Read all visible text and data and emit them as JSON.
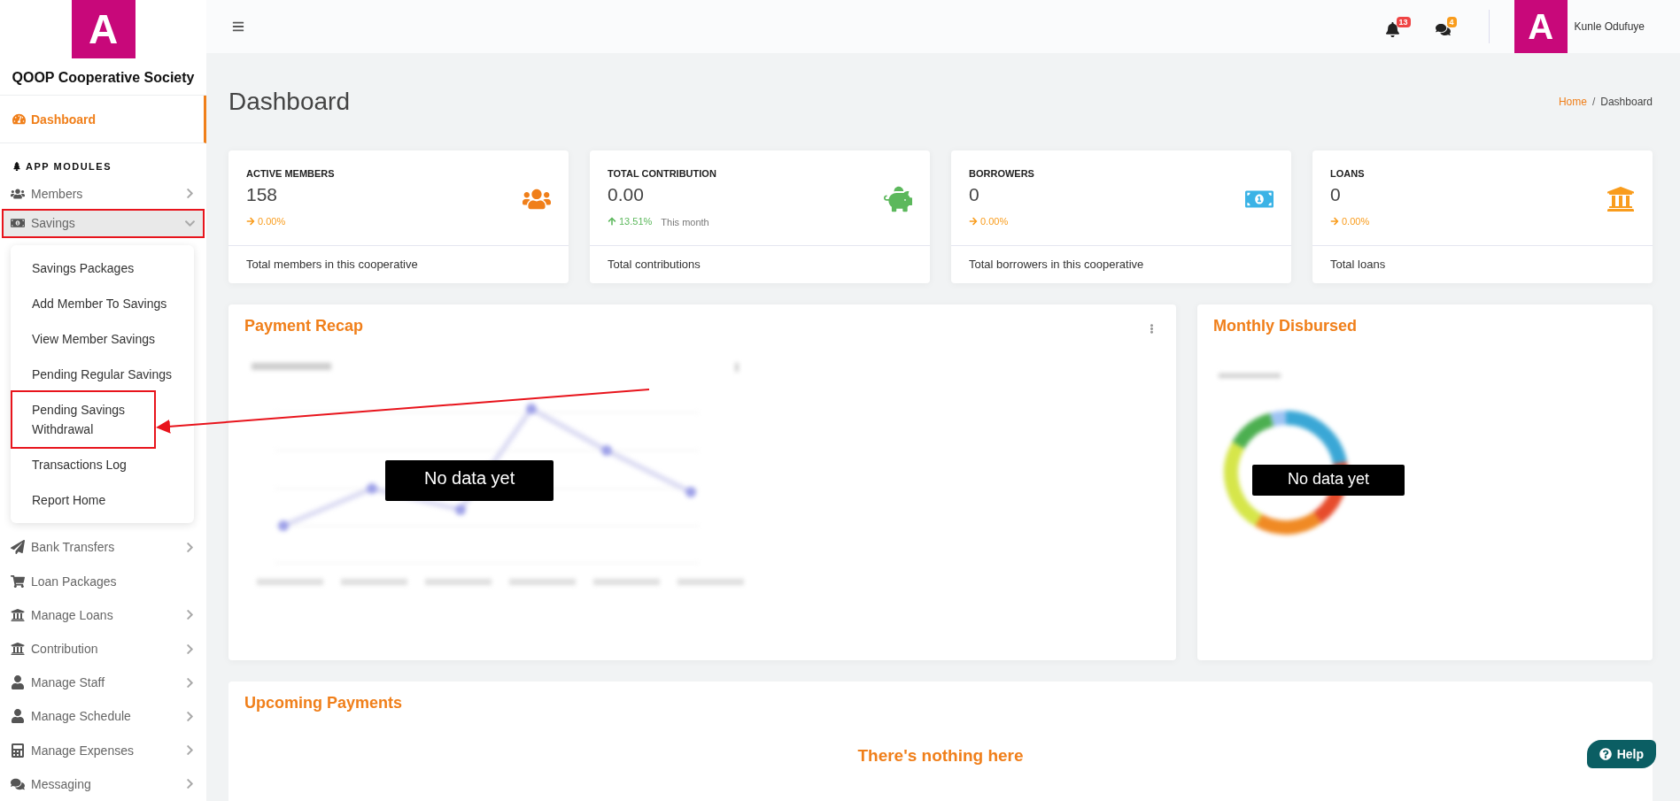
{
  "brand": {
    "logo_letter": "A",
    "name": "QOOP Cooperative Society"
  },
  "sidebar": {
    "top_item": {
      "label": "Dashboard",
      "selected": true
    },
    "section_title": "APP MODULES",
    "items": [
      {
        "label": "Members",
        "expandable": true,
        "expanded": false,
        "highlighted": false
      },
      {
        "label": "Savings",
        "expandable": true,
        "expanded": true,
        "highlighted": true,
        "children": [
          {
            "label": "Savings Packages",
            "highlighted": false
          },
          {
            "label": "Add Member To Savings",
            "highlighted": false
          },
          {
            "label": "View Member Savings",
            "highlighted": false
          },
          {
            "label": "Pending Regular Savings",
            "highlighted": false
          },
          {
            "label": "Pending Savings Withdrawal",
            "highlighted": true
          },
          {
            "label": "Transactions Log",
            "highlighted": false
          },
          {
            "label": "Report Home",
            "highlighted": false
          }
        ]
      },
      {
        "label": "Bank Transfers",
        "expandable": true,
        "expanded": false,
        "highlighted": false
      },
      {
        "label": "Loan Packages",
        "expandable": false,
        "expanded": false,
        "highlighted": false
      },
      {
        "label": "Manage Loans",
        "expandable": true,
        "expanded": false,
        "highlighted": false
      },
      {
        "label": "Contribution",
        "expandable": true,
        "expanded": false,
        "highlighted": false
      },
      {
        "label": "Manage Staff",
        "expandable": true,
        "expanded": false,
        "highlighted": false
      },
      {
        "label": "Manage Schedule",
        "expandable": true,
        "expanded": false,
        "highlighted": false
      },
      {
        "label": "Manage Expenses",
        "expandable": true,
        "expanded": false,
        "highlighted": false
      },
      {
        "label": "Messaging",
        "expandable": true,
        "expanded": false,
        "highlighted": false
      }
    ]
  },
  "annotation_arrow": true,
  "header": {
    "notifications": "13",
    "messages": "4",
    "avatar_letter": "A",
    "user_name": "Kunle Odufuye"
  },
  "page": {
    "title": "Dashboard",
    "breadcrumb": [
      {
        "label": "Home",
        "selected": false
      },
      {
        "label": "Dashboard",
        "selected": true
      }
    ],
    "breadcrumb_separator": "/"
  },
  "stat_cards": [
    {
      "title": "ACTIVE MEMBERS",
      "value": "158",
      "kind": "flat",
      "change": "0.00%",
      "color": "#f07f1a",
      "footer": "Total members in this cooperative"
    },
    {
      "title": "TOTAL CONTRIBUTION",
      "value": "0.00",
      "kind": "up",
      "change": "13.51%",
      "period": "This month",
      "color": "#5cb85c",
      "footer": "Total contributions"
    },
    {
      "title": "BORROWERS",
      "value": "0",
      "kind": "flat",
      "change": "0.00%",
      "color": "#3bb3e6",
      "footer": "Total borrowers in this cooperative"
    },
    {
      "title": "LOANS",
      "value": "0",
      "kind": "flat",
      "change": "0.00%",
      "color": "#f99c1c",
      "footer": "Total loans"
    }
  ],
  "payment_recap": {
    "title": "Payment Recap",
    "empty_label": "No data yet"
  },
  "monthly_disbursed": {
    "title": "Monthly Disbursed",
    "empty_label": "No data yet"
  },
  "upcoming_payments": {
    "title": "Upcoming Payments",
    "empty_title": "There's nothing here"
  },
  "help_button": "Help"
}
